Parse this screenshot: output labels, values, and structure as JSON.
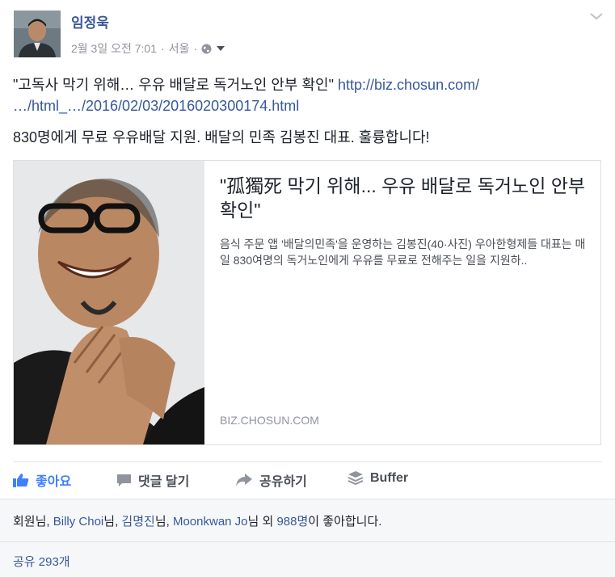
{
  "post": {
    "author": "임정욱",
    "date": "2월 3일 오전 7:01",
    "location": "서울",
    "text_quote": "\"고독사 막기 위해… 우유 배달로 독거노인 안부 확인\"",
    "link_part1": "http://biz.chosun.com/",
    "link_part2": "…/html_…/2016/02/03/2016020300174.html",
    "text_body": "830명에게 무료 우유배달 지원. 배달의 민족 김봉진 대표. 훌륭합니다!"
  },
  "card": {
    "title": "\"孤獨死 막기 위해... 우유 배달로 독거노인 안부 확인\"",
    "description": "음식 주문 앱 '배달의민족'을 운영하는 김봉진(40·사진) 우아한형제들 대표는 매일 830여명의 독거노인에게 우유를 무료로 전해주는 일을 지원하..",
    "domain": "BIZ.CHOSUN.COM"
  },
  "actions": {
    "like": "좋아요",
    "comment": "댓글 달기",
    "share": "공유하기",
    "buffer": "Buffer"
  },
  "likes": {
    "prefix": "회원님, ",
    "name1": "Billy Choi",
    "sep1": "님, ",
    "name2": "김명진",
    "sep2": "님, ",
    "name3": "Moonkwan Jo",
    "sep3": "님 외 ",
    "others": "988명",
    "suffix": "이 좋아합니다."
  },
  "shares": "공유 293개",
  "colors": {
    "link": "#365899",
    "like_active": "#4080ff",
    "meta": "#90949c"
  }
}
